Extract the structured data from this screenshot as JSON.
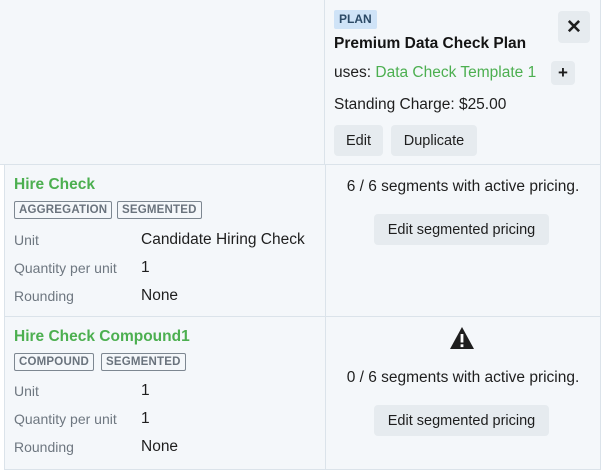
{
  "plan": {
    "badge": "PLAN",
    "title": "Premium Data Check Plan",
    "uses_label": "uses:",
    "template_link": "Data Check Template 1",
    "standing_charge": "Standing Charge: $25.00",
    "edit_label": "Edit",
    "duplicate_label": "Duplicate",
    "close_icon": "✕",
    "plus_icon": "+"
  },
  "items": [
    {
      "name": "Hire Check",
      "tags": [
        "AGGREGATION",
        "SEGMENTED"
      ],
      "unit_label": "Unit",
      "unit_value": "Candidate Hiring Check",
      "qty_label": "Quantity per unit",
      "qty_value": "1",
      "rounding_label": "Rounding",
      "rounding_value": "None",
      "pricing_status": "6 / 6 segments with active pricing.",
      "pricing_button": "Edit segmented pricing"
    },
    {
      "name": "Hire Check Compound1",
      "tags": [
        "COMPOUND",
        "SEGMENTED"
      ],
      "unit_label": "Unit",
      "unit_value": "1",
      "qty_label": "Quantity per unit",
      "qty_value": "1",
      "rounding_label": "Rounding",
      "rounding_value": "None",
      "pricing_status": "0 / 6 segments with active pricing.",
      "pricing_button": "Edit segmented pricing",
      "status_icon": "warning-icon"
    }
  ]
}
